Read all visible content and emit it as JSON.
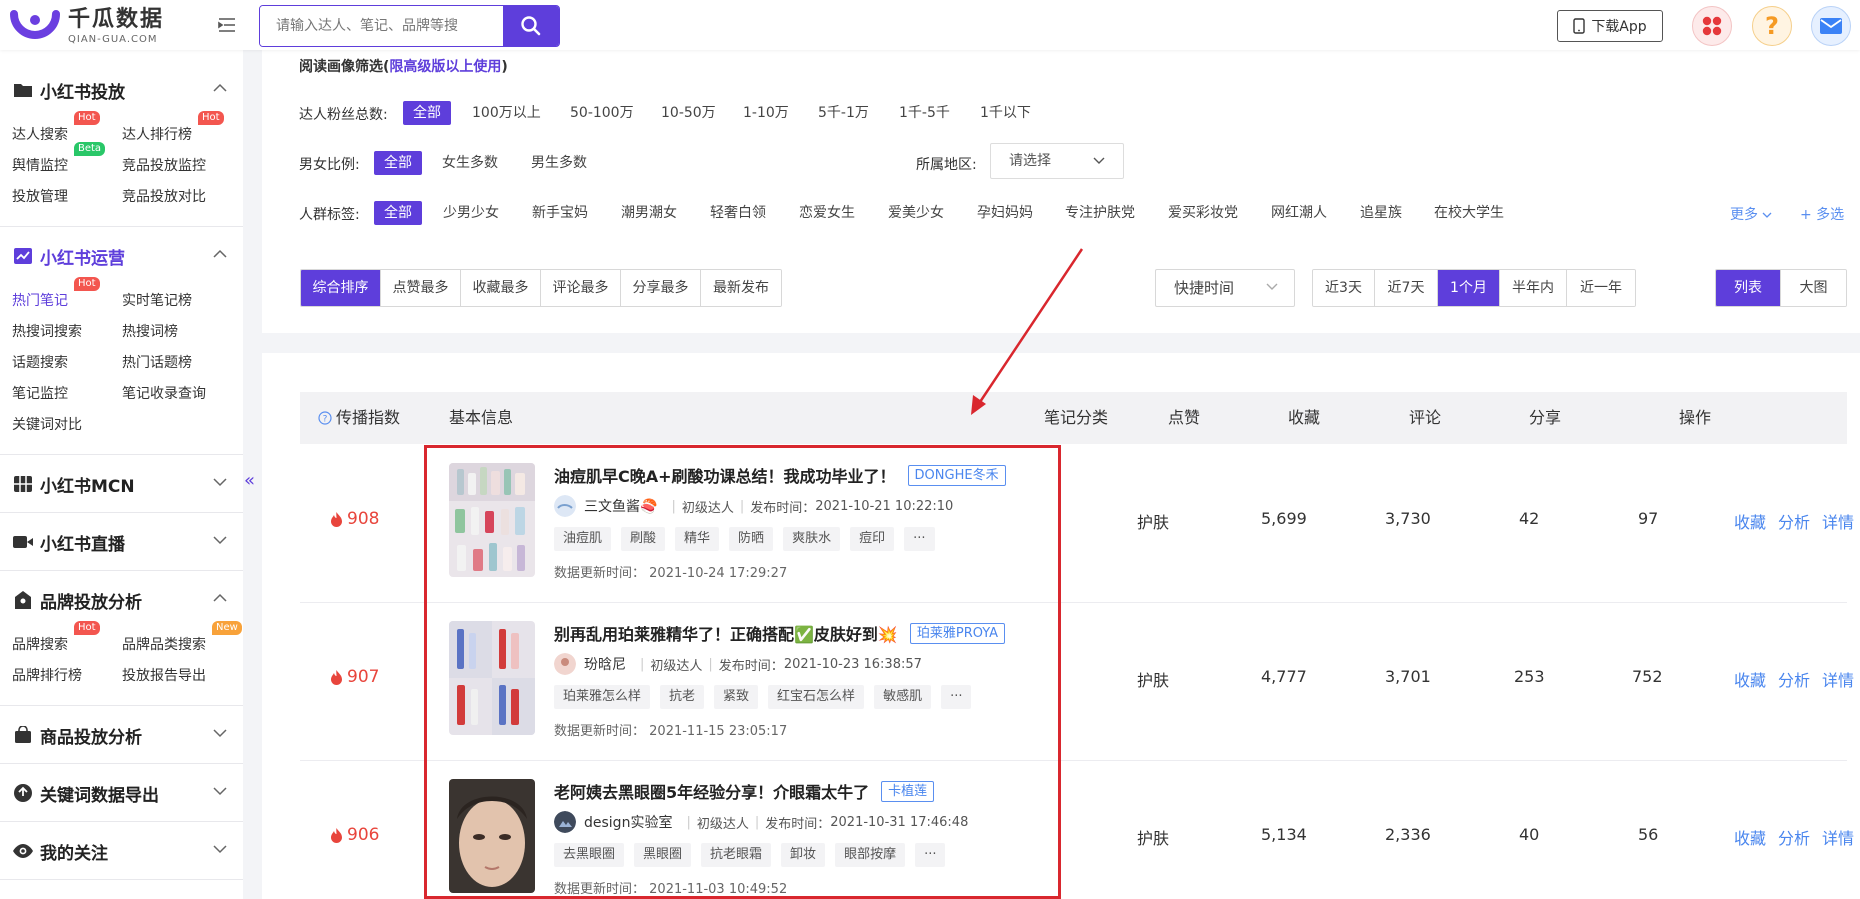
{
  "header": {
    "logo_cn": "千瓜数据",
    "logo_en": "QIAN-GUA.COM",
    "search_placeholder": "请输入达人、笔记、品牌等搜",
    "download_label": "下载App",
    "colors": {
      "brand": "#5e3edb",
      "hot": "#f3564f"
    }
  },
  "sidebar": {
    "sections": [
      {
        "title": "小红书投放",
        "icon": "folder-icon",
        "links": [
          "达人搜索",
          "达人排行榜",
          "舆情监控",
          "竞品投放监控",
          "投放管理",
          "竞品投放对比"
        ]
      },
      {
        "title": "小红书运营",
        "icon": "trend-chart-icon",
        "links": [
          "热门笔记",
          "实时笔记榜",
          "热搜词搜索",
          "热搜词榜",
          "话题搜索",
          "热门话题榜",
          "笔记监控",
          "笔记收录查询",
          "关键词对比"
        ]
      },
      {
        "title": "小红书MCN",
        "icon": "grid-icon"
      },
      {
        "title": "小红书直播",
        "icon": "video-icon"
      },
      {
        "title": "品牌投放分析",
        "icon": "brand-icon",
        "links": [
          "品牌搜索",
          "品牌品类搜索",
          "品牌排行榜",
          "投放报告导出"
        ]
      },
      {
        "title": "商品投放分析",
        "icon": "bag-icon"
      },
      {
        "title": "关键词数据导出",
        "icon": "export-icon"
      },
      {
        "title": "我的关注",
        "icon": "eye-icon"
      }
    ],
    "tags": {
      "hot": "Hot",
      "beta": "Beta",
      "new": "New"
    }
  },
  "filters": {
    "title": "阅读画像筛选(",
    "title_link": "限高级版以上使用",
    "title_end": ")",
    "fans_label": "达人粉丝总数:",
    "fans_options": [
      "全部",
      "100万以上",
      "50-100万",
      "10-50万",
      "1-10万",
      "5千-1万",
      "1千-5千",
      "1千以下"
    ],
    "gender_label": "男女比例:",
    "gender_options": [
      "全部",
      "女生多数",
      "男生多数"
    ],
    "region_label": "所属地区:",
    "region_placeholder": "请选择",
    "crowd_label": "人群标签:",
    "crowd_options": [
      "全部",
      "少男少女",
      "新手宝妈",
      "潮男潮女",
      "轻奢白领",
      "恋爱女生",
      "爱美少女",
      "孕妇妈妈",
      "专注护肤党",
      "爱买彩妆党",
      "网红潮人",
      "追星族",
      "在校大学生"
    ],
    "more_label": "更多",
    "multi_label": "+ 多选",
    "sort_options": [
      "综合排序",
      "点赞最多",
      "收藏最多",
      "评论最多",
      "分享最多",
      "最新发布"
    ],
    "time_select": "快捷时间",
    "range_options": [
      "近3天",
      "近7天",
      "1个月",
      "半年内",
      "近一年"
    ],
    "view_options": [
      "列表",
      "大图"
    ]
  },
  "table": {
    "headers": {
      "index": "传播指数",
      "basic": "基本信息",
      "category": "笔记分类",
      "likes": "点赞",
      "collects": "收藏",
      "comments": "评论",
      "shares": "分享",
      "actions": "操作"
    },
    "actions": [
      "收藏",
      "分析",
      "详情"
    ],
    "publish_prefix": "发布时间：",
    "update_prefix": "数据更新时间：",
    "rows": [
      {
        "heat": "908",
        "title": "油痘肌早C晚A+刷酸功课总结！我成功毕业了！",
        "brand": "DONGHE冬禾",
        "author": "三文鱼酱🍣",
        "level": "初级达人",
        "publish": "2021-10-21 10:22:10",
        "keywords": [
          "油痘肌",
          "刷酸",
          "精华",
          "防晒",
          "爽肤水",
          "痘印",
          "···"
        ],
        "updated": "2021-10-24 17:29:27",
        "category": "护肤",
        "likes": "5,699",
        "collects": "3,730",
        "comments": "42",
        "shares": "97"
      },
      {
        "heat": "907",
        "title": "别再乱用珀莱雅精华了！正确搭配✅皮肤好到💥",
        "brand": "珀莱雅PROYA",
        "author": "玢晗尼",
        "level": "初级达人",
        "publish": "2021-10-23 16:38:57",
        "keywords": [
          "珀莱雅怎么样",
          "抗老",
          "紧致",
          "红宝石怎么样",
          "敏感肌",
          "···"
        ],
        "updated": "2021-11-15 23:05:17",
        "category": "护肤",
        "likes": "4,777",
        "collects": "3,701",
        "comments": "253",
        "shares": "752"
      },
      {
        "heat": "906",
        "title": "老阿姨去黑眼圈5年经验分享！介眼霜太牛了",
        "brand": "卡植莲",
        "author": "design实验室",
        "level": "初级达人",
        "publish": "2021-10-31 17:46:48",
        "keywords": [
          "去黑眼圈",
          "黑眼圈",
          "抗老眼霜",
          "卸妆",
          "眼部按摩",
          "···"
        ],
        "updated": "2021-11-03 10:49:52",
        "category": "护肤",
        "likes": "5,134",
        "collects": "2,336",
        "comments": "40",
        "shares": "56"
      }
    ]
  }
}
